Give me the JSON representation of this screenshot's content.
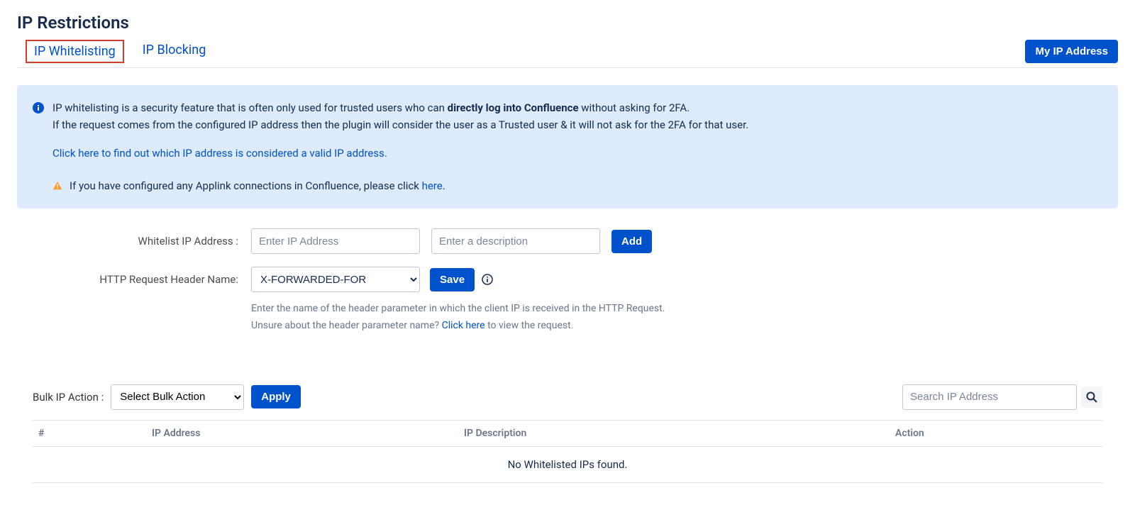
{
  "page": {
    "title": "IP Restrictions"
  },
  "tabs": {
    "whitelisting": "IP Whitelisting",
    "blocking": "IP Blocking",
    "myip_button": "My IP Address"
  },
  "info_panel": {
    "line1_pre": "IP whitelisting is a security feature that is often only used for trusted users who can ",
    "line1_bold": "directly log into Confluence",
    "line1_post": " without asking for 2FA.",
    "line2": "If the request comes from the configured IP address then the plugin will consider the user as a Trusted user & it will not ask for the 2FA for that user.",
    "link_valid_ip": "Click here to find out which IP address is considered a valid IP address.",
    "warn_pre": "If you have configured any Applink connections in Confluence, please click ",
    "warn_link": "here",
    "warn_post": "."
  },
  "form": {
    "whitelist_label": "Whitelist IP Address :",
    "ip_placeholder": "Enter IP Address",
    "desc_placeholder": "Enter a description",
    "add_button": "Add",
    "header_label": "HTTP Request Header Name:",
    "header_selected": "X-FORWARDED-FOR",
    "save_button": "Save",
    "hint1": "Enter the name of the header parameter in which the client IP is received in the HTTP Request.",
    "hint2_pre": "Unsure about the header parameter name? ",
    "hint2_link": "Click here",
    "hint2_post": " to view the request."
  },
  "bulk": {
    "label": "Bulk IP Action :",
    "select_placeholder": "Select Bulk Action",
    "apply_button": "Apply",
    "search_placeholder": "Search IP Address"
  },
  "table": {
    "col_index": "#",
    "col_ip": "IP Address",
    "col_desc": "IP Description",
    "col_action": "Action",
    "empty_message": "No Whitelisted IPs found."
  }
}
